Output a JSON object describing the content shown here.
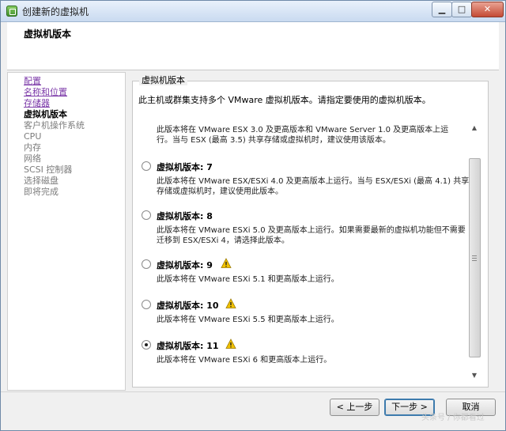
{
  "window": {
    "title": "创建新的虚拟机"
  },
  "header": {
    "title": "虚拟机版本"
  },
  "sidebar": {
    "items": [
      {
        "label": "配置",
        "state": "link"
      },
      {
        "label": "名称和位置",
        "state": "link"
      },
      {
        "label": "存储器",
        "state": "link"
      },
      {
        "label": "虚拟机版本",
        "state": "current"
      },
      {
        "label": "客户机操作系统",
        "state": "pending"
      },
      {
        "label": "CPU",
        "state": "pending"
      },
      {
        "label": "内存",
        "state": "pending"
      },
      {
        "label": "网络",
        "state": "pending"
      },
      {
        "label": "SCSI 控制器",
        "state": "pending"
      },
      {
        "label": "选择磁盘",
        "state": "pending"
      },
      {
        "label": "即将完成",
        "state": "pending"
      }
    ]
  },
  "group": {
    "legend": "虚拟机版本",
    "description": "此主机或群集支持多个 VMware 虚拟机版本。请指定要使用的虚拟机版本。"
  },
  "versions": {
    "partial_desc": "此版本将在 VMware ESX 3.0 及更高版本和 VMware Server 1.0 及更高版本上运行。当与 ESX (最高 3.5) 共享存储或虚拟机时，建议使用该版本。",
    "options": [
      {
        "label": "虚拟机版本: 7",
        "desc": "此版本将在 VMware ESX/ESXi 4.0 及更高版本上运行。当与 ESX/ESXi (最高 4.1) 共享存储或虚拟机时，建议使用此版本。",
        "warning": false,
        "selected": false
      },
      {
        "label": "虚拟机版本: 8",
        "desc": "此版本将在 VMware ESXi 5.0 及更高版本上运行。如果需要最新的虚拟机功能但不需要迁移到 ESX/ESXi 4，请选择此版本。",
        "warning": false,
        "selected": false
      },
      {
        "label": "虚拟机版本: 9",
        "desc": "此版本将在 VMware ESXi 5.1 和更高版本上运行。",
        "warning": true,
        "selected": false
      },
      {
        "label": "虚拟机版本: 10",
        "desc": "此版本将在 VMware ESXi 5.5 和更高版本上运行。",
        "warning": true,
        "selected": false
      },
      {
        "label": "虚拟机版本: 11",
        "desc": "此版本将在 VMware ESXi 6 和更高版本上运行。",
        "warning": true,
        "selected": true
      }
    ]
  },
  "footer": {
    "prev": "< 上一步",
    "next": "下一步 >",
    "cancel": "取消"
  },
  "watermark": "头条号 / 你都看过",
  "colors": {
    "visited_link": "#7b38a8",
    "warning": "#f2c200",
    "muted": "#7c7c7c"
  }
}
